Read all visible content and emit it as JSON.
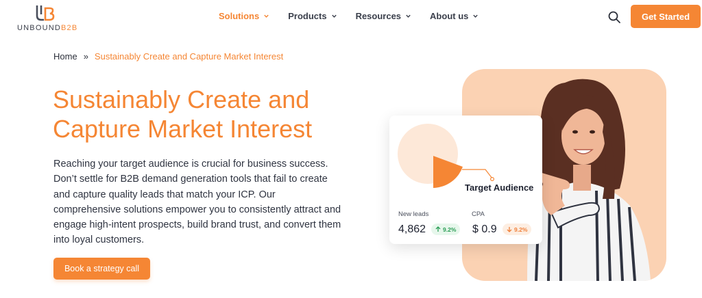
{
  "brand": {
    "logo_text_main": "UNBOUND",
    "logo_text_accent": "B2B",
    "accent_color": "#f58634"
  },
  "nav": {
    "items": [
      {
        "label": "Solutions",
        "active": true
      },
      {
        "label": "Products",
        "active": false
      },
      {
        "label": "Resources",
        "active": false
      },
      {
        "label": "About us",
        "active": false
      }
    ],
    "search_icon": "search-icon",
    "cta_label": "Get Started"
  },
  "breadcrumb": {
    "home": "Home",
    "separator": "»",
    "current": "Sustainably Create and Capture Market Interest"
  },
  "hero": {
    "title": "Sustainably Create and Capture Market Interest",
    "body": "Reaching your target audience is crucial for business success. Don’t settle for B2B demand generation tools that fail to create and capture quality leads that match your ICP. Our comprehensive solutions empower you to consistently attract and engage high-intent prospects, build brand trust, and convert them into loyal customers.",
    "cta_label": "Book a strategy call"
  },
  "card": {
    "audience_label": "Target Audience",
    "stats": [
      {
        "label": "New leads",
        "value": "4,862",
        "change": "9.2%",
        "direction": "up"
      },
      {
        "label": "CPA",
        "value": "$ 0.9",
        "change": "9.2%",
        "direction": "down"
      }
    ]
  }
}
